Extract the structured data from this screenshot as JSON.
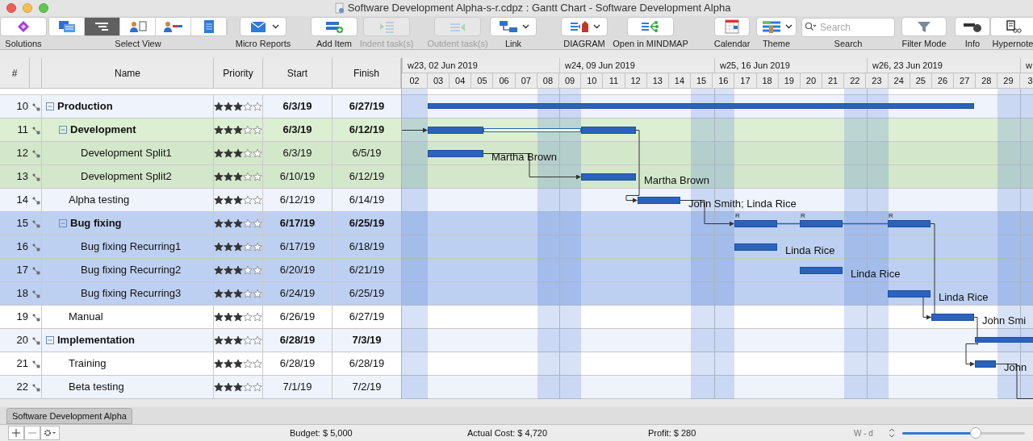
{
  "window": {
    "title": "Software Development Alpha-s-r.cdpz : Gantt Chart - Software Development Alpha"
  },
  "toolbar": [
    {
      "kind": "button",
      "label": "Solutions",
      "disabled": false
    },
    {
      "kind": "segmented",
      "label": "Select View",
      "segments": [
        {
          "selected": false
        },
        {
          "selected": true
        },
        {
          "selected": false
        },
        {
          "selected": false
        },
        {
          "selected": false
        }
      ]
    },
    {
      "kind": "dropdown",
      "label": "Micro Reports",
      "disabled": false
    },
    {
      "kind": "button",
      "label": "Add Item",
      "disabled": false
    },
    {
      "kind": "button",
      "label": "Indent task(s)",
      "disabled": true
    },
    {
      "kind": "button",
      "label": "Outdent task(s)",
      "disabled": true
    },
    {
      "kind": "dropdown",
      "label": "Link",
      "disabled": false
    },
    {
      "kind": "dropdown",
      "label": "DIAGRAM",
      "disabled": false
    },
    {
      "kind": "button",
      "label": "Open in MINDMAP",
      "disabled": false
    },
    {
      "kind": "button",
      "label": "Calendar",
      "disabled": false
    },
    {
      "kind": "dropdown",
      "label": "Theme",
      "disabled": false
    },
    {
      "kind": "search",
      "label": "Search",
      "placeholder": "Search"
    },
    {
      "kind": "button",
      "label": "Filter Mode",
      "disabled": false
    },
    {
      "kind": "button",
      "label": "Info",
      "disabled": false
    },
    {
      "kind": "button",
      "label": "Hypernote",
      "disabled": false
    }
  ],
  "table": {
    "columns": [
      "#",
      "Name",
      "Priority",
      "Start",
      "Finish"
    ],
    "rows": [
      {
        "num": "10",
        "name": "Production",
        "expanded": true,
        "stars": 3,
        "start": "6/3/19",
        "finish": "6/27/19",
        "color": "#eef3fc",
        "children": [
          {
            "num": "11",
            "name": "Development",
            "expanded": true,
            "stars": 3,
            "start": "6/3/19",
            "finish": "6/12/19",
            "color": "#dcefd3",
            "children": [
              {
                "num": "12",
                "name": "Development Split1",
                "stars": 3,
                "start": "6/3/19",
                "finish": "6/5/19",
                "color": "#d3e8ca",
                "resource": "Martha Brown"
              },
              {
                "num": "13",
                "name": "Development Split2",
                "stars": 3,
                "start": "6/10/19",
                "finish": "6/12/19",
                "color": "#d3e8ca",
                "resource": "Martha Brown"
              }
            ]
          },
          {
            "num": "14",
            "name": "Alpha testing",
            "stars": 3,
            "start": "6/12/19",
            "finish": "6/14/19",
            "color": "#eef3fc",
            "resource": "John Smith; Linda Rice"
          },
          {
            "num": "15",
            "name": "Bug fixing",
            "expanded": true,
            "stars": 3,
            "start": "6/17/19",
            "finish": "6/25/19",
            "color": "#bdd0f1",
            "children": [
              {
                "num": "16",
                "name": "Bug fixing Recurring1",
                "stars": 3,
                "start": "6/17/19",
                "finish": "6/18/19",
                "color": "#bdd0f1",
                "resource": "Linda Rice"
              },
              {
                "num": "17",
                "name": "Bug fixing Recurring2",
                "stars": 3,
                "start": "6/20/19",
                "finish": "6/21/19",
                "color": "#bdd0f1",
                "resource": "Linda Rice"
              },
              {
                "num": "18",
                "name": "Bug fixing Recurring3",
                "stars": 3,
                "start": "6/24/19",
                "finish": "6/25/19",
                "color": "#bdd0f1",
                "resource": "Linda Rice"
              }
            ]
          },
          {
            "num": "19",
            "name": "Manual",
            "stars": 3,
            "start": "6/26/19",
            "finish": "6/27/19",
            "color": "#ffffff",
            "resource": "John Smi"
          }
        ]
      },
      {
        "num": "20",
        "name": "Implementation",
        "expanded": true,
        "stars": 3,
        "start": "6/28/19",
        "finish": "7/3/19",
        "color": "#eef3fc",
        "children": [
          {
            "num": "21",
            "name": "Training",
            "stars": 3,
            "start": "6/28/19",
            "finish": "6/28/19",
            "color": "#ffffff",
            "resource": "John"
          },
          {
            "num": "22",
            "name": "Beta testing",
            "stars": 3,
            "start": "7/1/19",
            "finish": "7/2/19",
            "color": "#eef3fc"
          }
        ]
      }
    ]
  },
  "timeline": {
    "weeks": [
      "w23, 02 Jun 2019",
      "w24, 09 Jun 2019",
      "w25, 16 Jun 2019",
      "w26, 23 Jun 2019",
      "w"
    ],
    "days": [
      {
        "label": "02",
        "weekend": true
      },
      {
        "label": "03",
        "weekend": false
      },
      {
        "label": "04",
        "weekend": false
      },
      {
        "label": "05",
        "weekend": false
      },
      {
        "label": "06",
        "weekend": false
      },
      {
        "label": "07",
        "weekend": false
      },
      {
        "label": "08",
        "weekend": true
      },
      {
        "label": "09",
        "weekend": true
      },
      {
        "label": "10",
        "weekend": false
      },
      {
        "label": "11",
        "weekend": false
      },
      {
        "label": "12",
        "weekend": false
      },
      {
        "label": "13",
        "weekend": false
      },
      {
        "label": "14",
        "weekend": false
      },
      {
        "label": "15",
        "weekend": true
      },
      {
        "label": "16",
        "weekend": true
      },
      {
        "label": "17",
        "weekend": false
      },
      {
        "label": "18",
        "weekend": false
      },
      {
        "label": "19",
        "weekend": false
      },
      {
        "label": "20",
        "weekend": false
      },
      {
        "label": "21",
        "weekend": false
      },
      {
        "label": "22",
        "weekend": true
      },
      {
        "label": "23",
        "weekend": true
      },
      {
        "label": "24",
        "weekend": false
      },
      {
        "label": "25",
        "weekend": false
      },
      {
        "label": "26",
        "weekend": false
      },
      {
        "label": "27",
        "weekend": false
      },
      {
        "label": "28",
        "weekend": false
      },
      {
        "label": "29",
        "weekend": true
      },
      {
        "label": "3",
        "weekend": true
      }
    ],
    "recurring_marks": [
      "R",
      "R",
      "R"
    ]
  },
  "sheet_tab": {
    "label": "Software Development Alpha"
  },
  "status_bar": {
    "budget": "Budget: $ 5,000",
    "actual_cost": "Actual Cost: $ 4,720",
    "profit": "Profit: $ 280",
    "scale": "W - d",
    "zoom": {
      "level": 0.6
    }
  }
}
